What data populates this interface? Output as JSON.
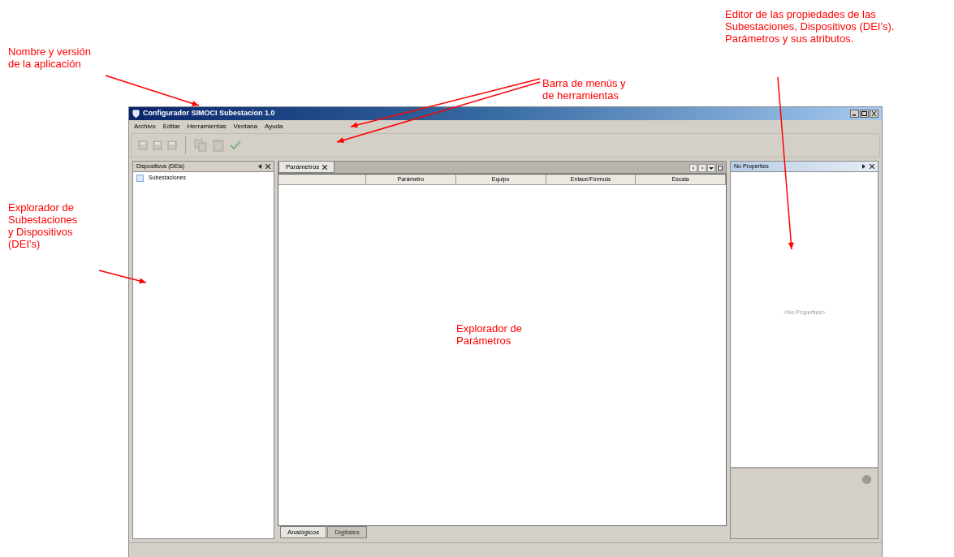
{
  "annotations": [
    {
      "kind": "app",
      "lines": [
        "Nombre y versión",
        "de la aplicación"
      ]
    },
    {
      "kind": "menus",
      "lines": [
        "Barra de menús y",
        "de herramientas"
      ]
    },
    {
      "kind": "editor",
      "lines": [
        "Editor de las propiedades de las",
        "Subestaciones, Dispositivos (DEI's).",
        "Parámetros y sus atributos."
      ]
    },
    {
      "kind": "explorer",
      "lines": [
        "Explorador de",
        "Subestaciones",
        "y Dispositivos",
        "(DEI's)"
      ]
    },
    {
      "kind": "params",
      "lines": [
        "Explorador de",
        "Parámetros"
      ]
    }
  ],
  "window": {
    "title": "Configurador SIMOCI Subestacion 1.0"
  },
  "menu": [
    "Archivo",
    "Editar",
    "Herramientas",
    "Ventana",
    "Ayuda"
  ],
  "left_panel": {
    "title": "Dispositivos (DEIs)",
    "tree": [
      {
        "label": "Subestaciones"
      }
    ]
  },
  "center_panel": {
    "tabs": [
      {
        "label": "Parámetros",
        "selected": true
      }
    ],
    "table": {
      "columns": [
        "Parámetro",
        "Equipo",
        "Enlace/Fórmula",
        "Escala"
      ]
    },
    "bottom_tabs": [
      {
        "label": "Analógicos",
        "selected": true
      },
      {
        "label": "Digitales",
        "selected": false
      }
    ]
  },
  "right_panel": {
    "title": "No Properties",
    "empty_text": "<No Properties>"
  }
}
